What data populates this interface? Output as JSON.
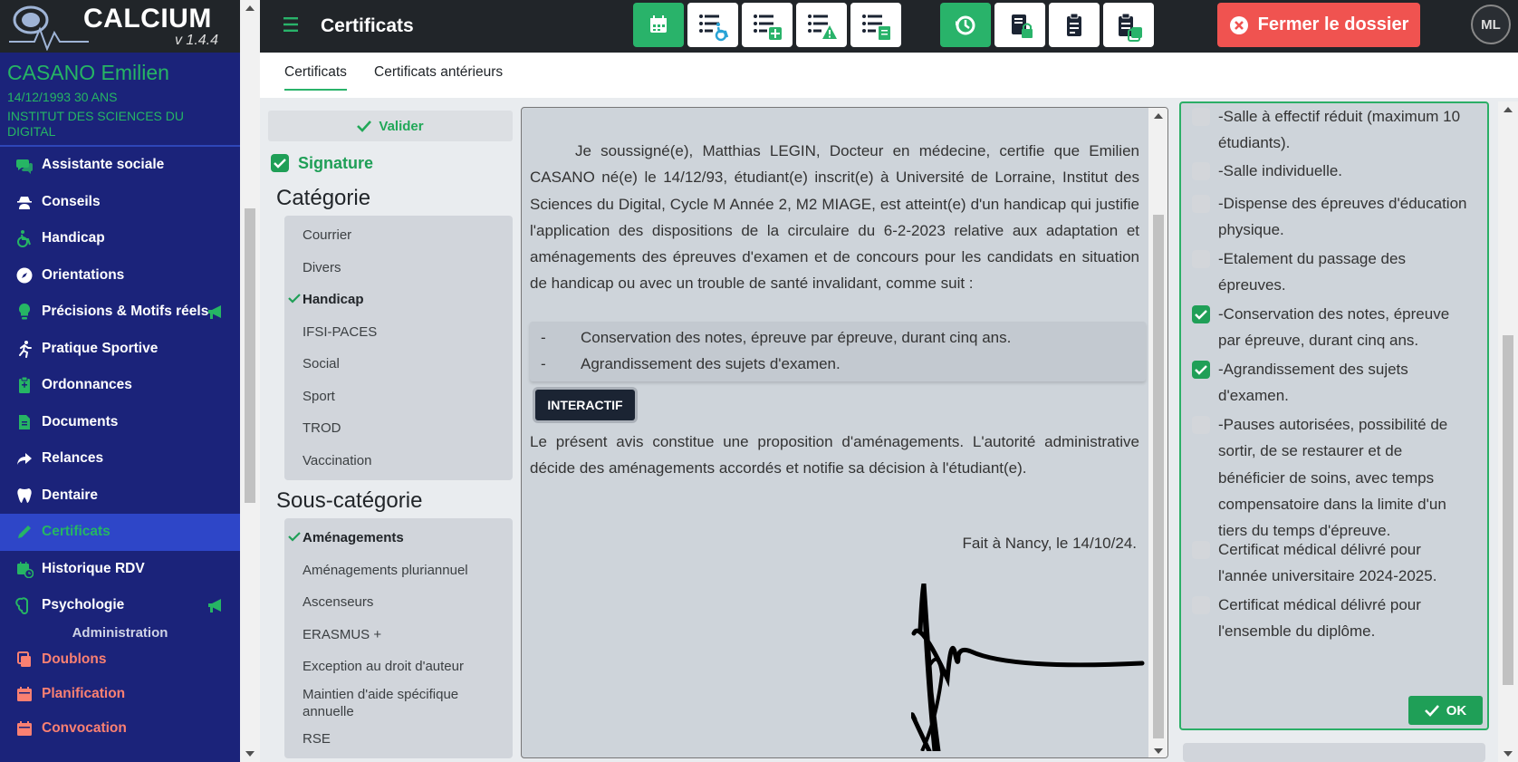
{
  "app": {
    "name": "CALCIUM",
    "version": "v 1.4.4"
  },
  "patient": {
    "name": "CASANO Emilien",
    "birth_age": "14/12/1993  30 ANS",
    "school": "INSTITUT DES SCIENCES DU DIGITAL"
  },
  "sidebar": {
    "items": [
      {
        "label": "Assistante sociale",
        "icon": "comments-icon"
      },
      {
        "label": "Conseils",
        "icon": "user-secret-icon"
      },
      {
        "label": "Handicap",
        "icon": "wheelchair-icon"
      },
      {
        "label": "Orientations",
        "icon": "compass-icon"
      },
      {
        "label": "Précisions & Motifs réels",
        "icon": "lightbulb-icon",
        "badge": "megaphone-icon"
      },
      {
        "label": "Pratique Sportive",
        "icon": "running-icon"
      },
      {
        "label": "Ordonnances",
        "icon": "prescription-icon"
      },
      {
        "label": "Documents",
        "icon": "file-icon"
      },
      {
        "label": "Relances",
        "icon": "share-arrow-icon"
      },
      {
        "label": "Dentaire",
        "icon": "tooth-icon"
      },
      {
        "label": "Certificats",
        "icon": "pencil-icon",
        "active": true
      },
      {
        "label": "Historique RDV",
        "icon": "calendar-clock-icon"
      },
      {
        "label": "Psychologie",
        "icon": "brain-icon",
        "badge": "megaphone-icon"
      }
    ],
    "admin_section": "Administration",
    "admin_items": [
      {
        "label": "Doublons",
        "icon": "copy-icon"
      },
      {
        "label": "Planification",
        "icon": "calendar-icon"
      },
      {
        "label": "Convocation",
        "icon": "calendar-check-icon"
      }
    ]
  },
  "topbar": {
    "title": "Certificats",
    "close_label": "Fermer le dossier",
    "avatar": "ML",
    "colors": {
      "green": "#29b36a",
      "red": "#f05350",
      "dark": "#212529"
    }
  },
  "tabs": [
    "Certificats",
    "Certificats antérieurs"
  ],
  "categories": {
    "validate_label": "Valider",
    "signature_label": "Signature",
    "category_title": "Catégorie",
    "category_items": [
      "Courrier",
      "Divers",
      "Handicap",
      "IFSI-PACES",
      "Social",
      "Sport",
      "TROD",
      "Vaccination"
    ],
    "category_selected": "Handicap",
    "subcategory_title": "Sous-catégorie",
    "subcategory_items": [
      "Aménagements",
      "Aménagements pluriannuel",
      "Ascenseurs",
      "ERASMUS +",
      "Exception au droit d'auteur",
      "Maintien d'aide spécifique annuelle",
      "RSE"
    ],
    "subcategory_selected": "Aménagements"
  },
  "document": {
    "paragraph": "Je soussigné(e), Matthias LEGIN, Docteur en médecine, certifie que Emilien CASANO né(e) le 14/12/93, étudiant(e) inscrit(e) à Université de Lorraine, Institut des Sciences du Digital, Cycle M Année 2, M2 MIAGE, est atteint(e) d'un handicap qui justifie l'application des dispositions de la circulaire du 6-2-2023 relative aux adaptation et aménagements des épreuves d'examen et de concours pour les candidats en situation de handicap ou avec un trouble de santé invalidant, comme suit :",
    "list": [
      {
        "dash": "-",
        "text": "Conservation des notes, épreuve par épreuve, durant cinq ans."
      },
      {
        "dash": "-",
        "text": "Agrandissement des sujets d'examen."
      }
    ],
    "interactive_label": "INTERACTIF",
    "closing": "Le présent avis constitue une proposition d'aménagements. L'autorité administrative décide des aménagements accordés et notifie sa décision à l'étudiant(e).",
    "place_date": "Fait à Nancy, le 14/10/24."
  },
  "options": {
    "items": [
      {
        "text": "-Salle à effectif réduit (maximum 10 étudiants).",
        "checked": false
      },
      {
        "text": "-Salle individuelle.",
        "checked": false
      },
      {
        "text": "-Dispense des épreuves d'éducation physique.",
        "checked": false
      },
      {
        "text": "-Etalement du passage des épreuves.",
        "checked": false
      },
      {
        "text": "-Conservation des notes, épreuve par épreuve, durant cinq ans.",
        "checked": true
      },
      {
        "text": "-Agrandissement des sujets d'examen.",
        "checked": true
      },
      {
        "text": "-Pauses autorisées, possibilité de sortir, de se restaurer et de bénéficier de soins, avec temps compensatoire dans la limite d'un tiers du temps d'épreuve.",
        "checked": false
      },
      {
        "text": "Certificat médical délivré pour l'année universitaire 2024-2025.",
        "checked": false
      },
      {
        "text": "Certificat médical délivré pour l'ensemble du diplôme.",
        "checked": false
      }
    ],
    "ok_label": "OK"
  }
}
